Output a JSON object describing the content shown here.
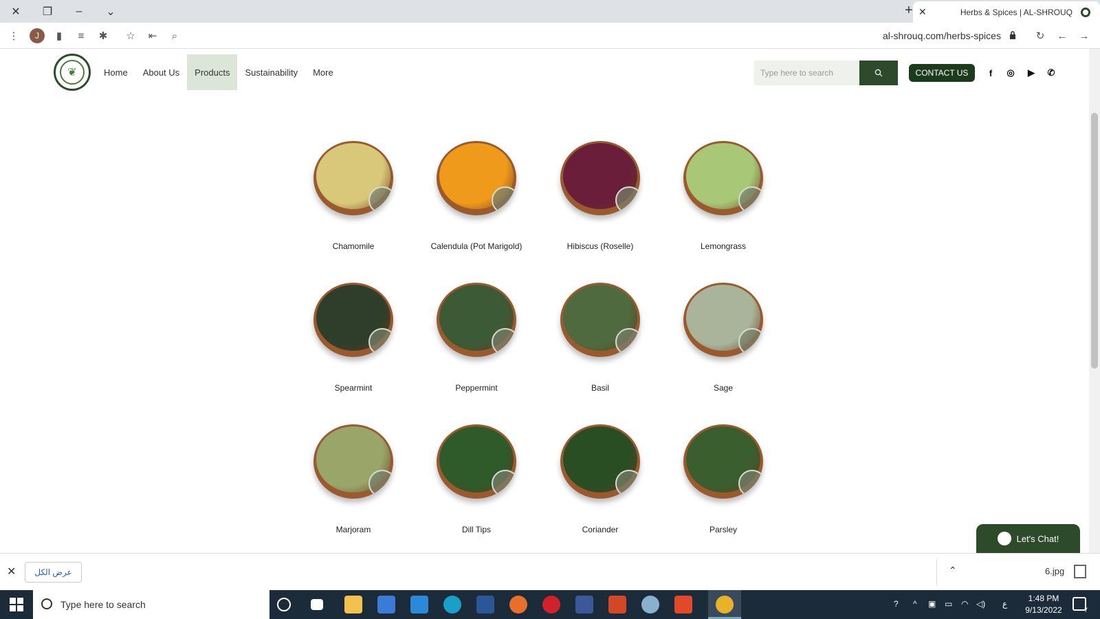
{
  "browser": {
    "tab_title": "Herbs & Spices | AL-SHROUQ",
    "url": "al-shrouq.com/herbs-spices",
    "profile_initial": "J"
  },
  "site": {
    "nav": [
      "Home",
      "About Us",
      "Products",
      "Sustainability",
      "More"
    ],
    "active_nav": "Products",
    "search_placeholder": "Type here to search",
    "contact_label": "CONTACT US"
  },
  "products": [
    {
      "name": "Chamomile",
      "color": "#d9c87a"
    },
    {
      "name": "Calendula (Pot Marigold)",
      "color": "#f09a1c"
    },
    {
      "name": "Hibiscus (Roselle)",
      "color": "#6b1e3a"
    },
    {
      "name": "Lemongrass",
      "color": "#a8c878"
    },
    {
      "name": "Spearmint",
      "color": "#2f3e2a"
    },
    {
      "name": "Peppermint",
      "color": "#3d5a36"
    },
    {
      "name": "Basil",
      "color": "#4e6a3e"
    },
    {
      "name": "Sage",
      "color": "#a9b49a"
    },
    {
      "name": "Marjoram",
      "color": "#9aa56a"
    },
    {
      "name": "Dill Tips",
      "color": "#2f5a2a"
    },
    {
      "name": "Coriander",
      "color": "#2a4e24"
    },
    {
      "name": "Parsley",
      "color": "#3a5e2e"
    }
  ],
  "chat": {
    "label": "Let's Chat!"
  },
  "download": {
    "show_all": "عرض الكل",
    "filename": "6.jpg"
  },
  "taskbar": {
    "search_placeholder": "Type here to search",
    "time": "1:48 PM",
    "date": "9/13/2022",
    "lang": "ع",
    "notification_count": "7"
  }
}
